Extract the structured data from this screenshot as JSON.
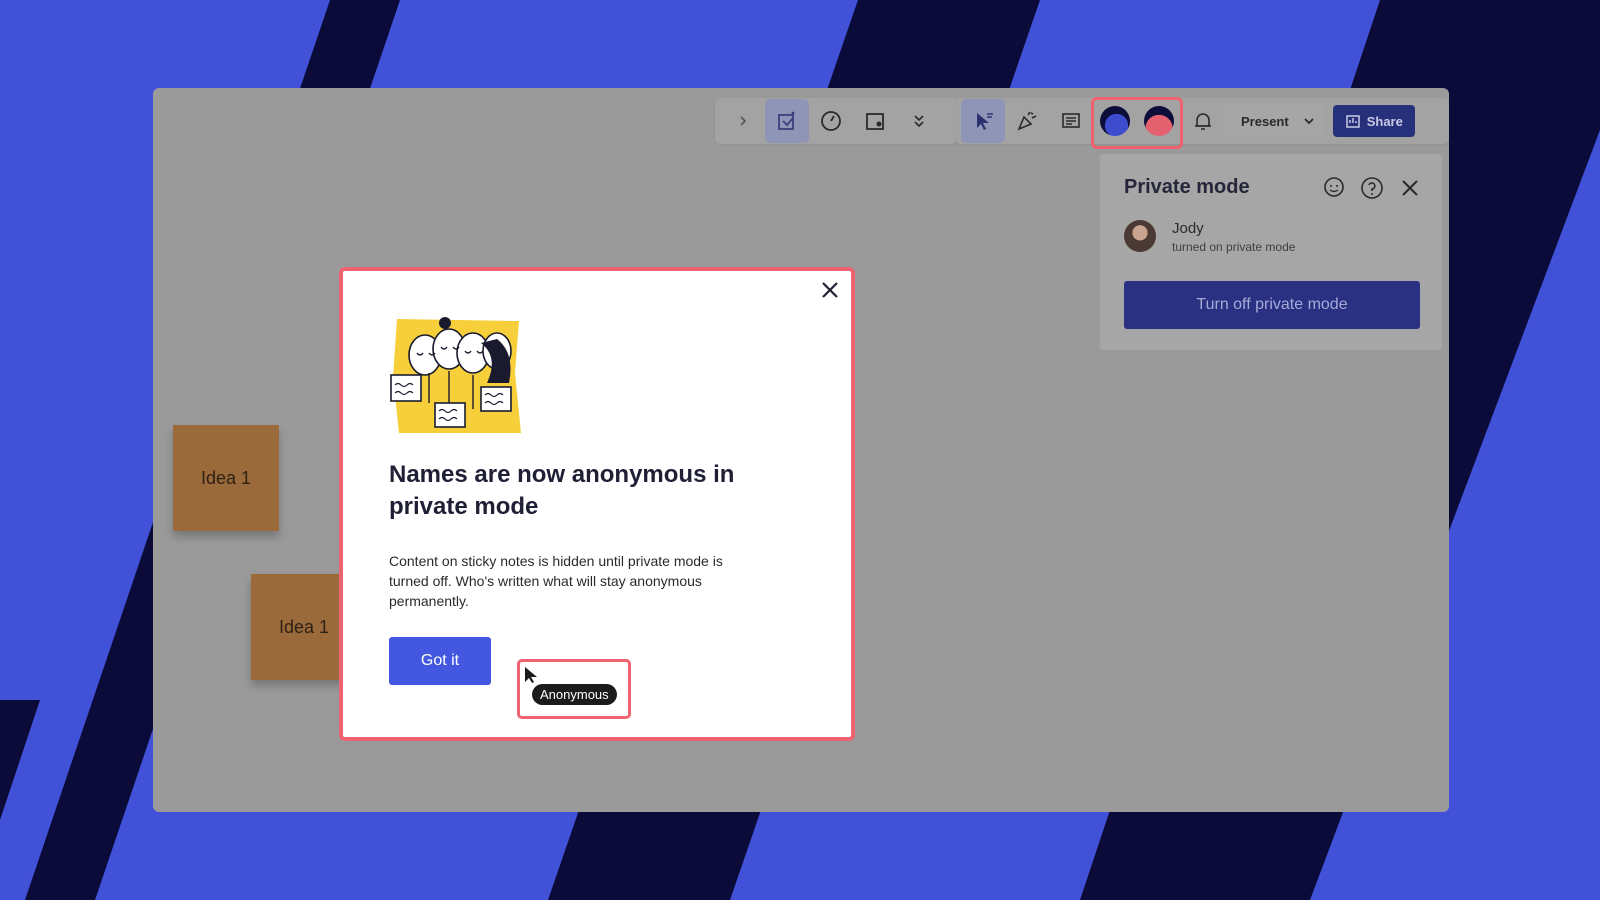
{
  "toolbar": {
    "present_label": "Present",
    "share_label": "Share",
    "icons": [
      "chevron-right-icon",
      "frames-icon",
      "timer-icon",
      "card-icon",
      "more-icon",
      "cursor-icon",
      "celebrate-icon",
      "comments-icon",
      "bell-icon"
    ]
  },
  "private_mode_panel": {
    "title": "Private mode",
    "user_name": "Jody",
    "user_status": "turned on private mode",
    "turn_off_label": "Turn off private mode"
  },
  "stickies": [
    {
      "label": "Idea 1"
    },
    {
      "label": "Idea 1"
    }
  ],
  "modal": {
    "title": "Names are now anonymous in private mode",
    "body": "Content on sticky notes is hidden until private mode is turned off. Who's written what will stay anonymous permanently.",
    "button_label": "Got it",
    "tag_label": "Anonymous"
  },
  "colors": {
    "background": "#4151d8",
    "stripe": "#0b0b3a",
    "highlight": "#ee6370",
    "primary": "#4357e0"
  }
}
